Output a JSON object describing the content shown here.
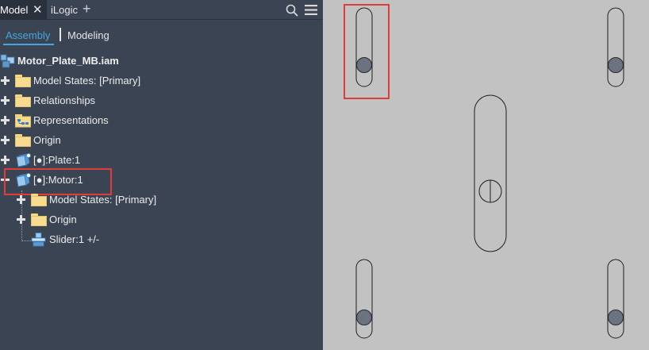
{
  "tabs": {
    "model": "Model",
    "close": "✕",
    "ilogic": "iLogic",
    "add": "+"
  },
  "subtabs": {
    "assembly": "Assembly",
    "modeling": "Modeling"
  },
  "tree": {
    "root": "Motor_Plate_MB.iam",
    "model_states": "Model States: [Primary]",
    "relationships": "Relationships",
    "representations": "Representations",
    "origin": "Origin",
    "plate": "[●]:Plate:1",
    "motor": "[●]:Motor:1",
    "motor_model_states": "Model States: [Primary]",
    "motor_origin": "Origin",
    "slider": "Slider:1 +/-"
  },
  "colors": {
    "panel_bg": "#3b4453",
    "accent": "#43a6e0",
    "highlight": "#e03c3c",
    "canvas_bg": "#c2c2c2",
    "folder": "#f7dc8f"
  },
  "icons": [
    "close-icon",
    "add-icon",
    "search-icon",
    "menu-icon",
    "assembly-icon",
    "folder-icon",
    "relationships-icon",
    "representations-icon",
    "part-icon",
    "slider-icon"
  ]
}
